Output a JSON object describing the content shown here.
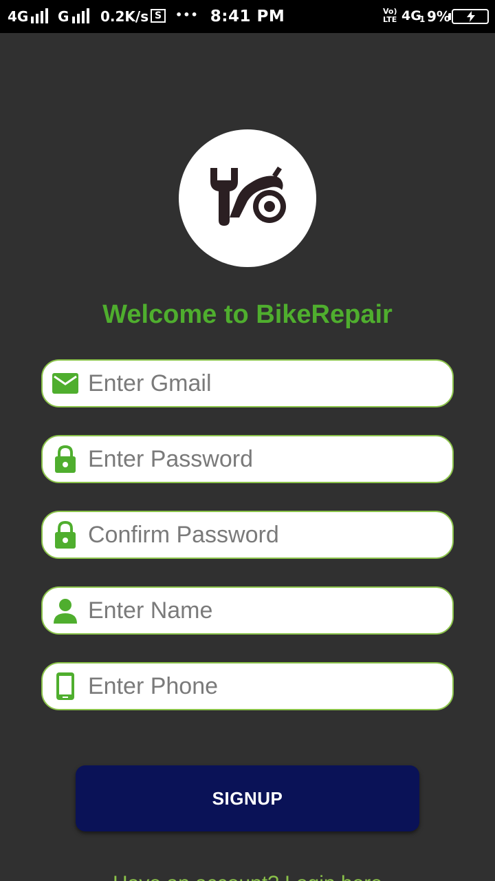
{
  "status_bar": {
    "network1": "4G",
    "network2": "G",
    "speed": "0.2K/s",
    "screenshot_glyph": "S",
    "more": "•••",
    "time": "8:41 PM",
    "volte_top": "Vo)",
    "volte_bottom": "LTE",
    "network3": "4G",
    "sim": "1",
    "battery": "9%"
  },
  "logo": {
    "icon": "bike-repair-icon",
    "color": "#2b1f22"
  },
  "welcome": {
    "title": "Welcome to BikeRepair"
  },
  "form": {
    "email": {
      "placeholder": "Enter Gmail",
      "value": "",
      "icon": "mail-icon"
    },
    "password": {
      "placeholder": "Enter Password",
      "value": "",
      "icon": "lock-icon"
    },
    "confirm_password": {
      "placeholder": "Confirm Password",
      "value": "",
      "icon": "lock-icon"
    },
    "name": {
      "placeholder": "Enter Name",
      "value": "",
      "icon": "person-icon"
    },
    "phone": {
      "placeholder": "Enter Phone",
      "value": "",
      "icon": "phone-icon"
    }
  },
  "signup_button": {
    "label": "SIGNUP"
  },
  "footer": {
    "login_link": "Have an account? Login here"
  },
  "colors": {
    "background": "#303030",
    "accent_green": "#4fae2e",
    "field_border": "#8bc34a",
    "button": "#0a1257"
  }
}
